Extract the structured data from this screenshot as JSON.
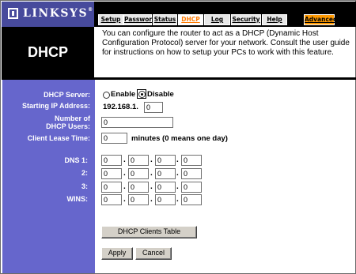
{
  "header": {
    "logo_text": "LINKSYS",
    "logo_mark": "®",
    "tabs": [
      {
        "label": "Setup"
      },
      {
        "label": "Password"
      },
      {
        "label": "Status"
      },
      {
        "label": "DHCP"
      },
      {
        "label": "Log"
      },
      {
        "label": "Security"
      },
      {
        "label": "Help"
      },
      {
        "label": "Advanced"
      }
    ],
    "active_tab": "DHCP"
  },
  "page": {
    "title": "DHCP",
    "intro": "You can configure the router to act as a DHCP (Dynamic Host Configuration Protocol) server for your network. Consult the user guide for instructions on how to setup your PCs to work with this feature."
  },
  "form": {
    "dhcp_server": {
      "label": "DHCP Server:",
      "enable_label": "Enable",
      "disable_label": "Disable",
      "selected": "Disable"
    },
    "starting_ip": {
      "label": "Starting IP Address:",
      "prefix": "192.168.1.",
      "value": "0"
    },
    "num_users": {
      "label_line1": "Number of",
      "label_line2": "DHCP Users:",
      "value": "0"
    },
    "lease_time": {
      "label": "Client Lease Time:",
      "value": "0",
      "suffix": "minutes (0 means one day)"
    },
    "dns1": {
      "label": "DNS 1:",
      "octets": [
        "0",
        "0",
        "0",
        "0"
      ]
    },
    "dns2": {
      "label": "2:",
      "octets": [
        "0",
        "0",
        "0",
        "0"
      ]
    },
    "dns3": {
      "label": "3:",
      "octets": [
        "0",
        "0",
        "0",
        "0"
      ]
    },
    "wins": {
      "label": "WINS:",
      "octets": [
        "0",
        "0",
        "0",
        "0"
      ]
    },
    "separator": "."
  },
  "buttons": {
    "clients_table": "DHCP Clients Table",
    "apply": "Apply",
    "cancel": "Cancel"
  },
  "colors": {
    "accent_purple": "#474a9c",
    "side_panel": "#6666cc",
    "active_tab_text": "#ff7a00",
    "advanced_tab": "#ff9900"
  }
}
